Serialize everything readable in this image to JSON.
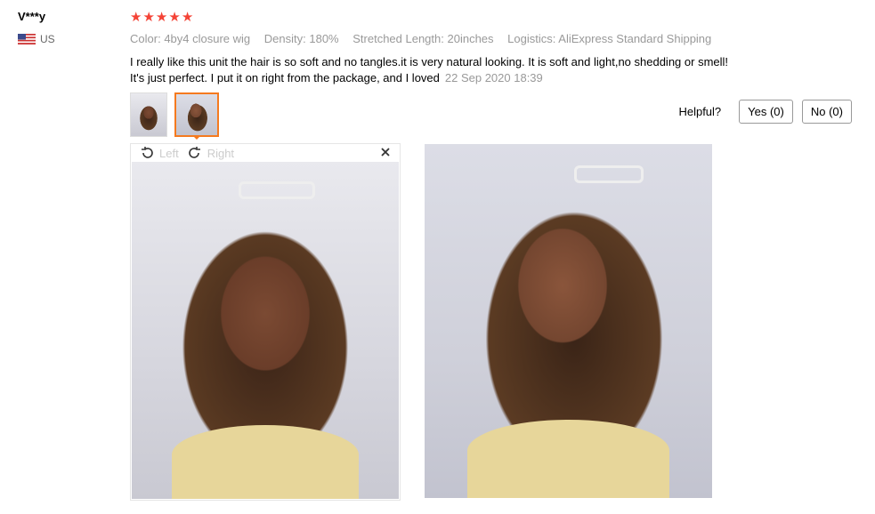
{
  "user": {
    "name": "V***y",
    "country": "US"
  },
  "rating": {
    "stars": 5
  },
  "attributes": [
    {
      "label": "Color:",
      "value": "4by4 closure wig"
    },
    {
      "label": "Density:",
      "value": "180%"
    },
    {
      "label": "Stretched Length:",
      "value": "20inches"
    },
    {
      "label": "Logistics:",
      "value": "AliExpress Standard Shipping"
    }
  ],
  "review": {
    "line1": "I really like this unit the hair is so soft and no tangles.it is very natural looking. It is soft and light,no shedding or smell!",
    "line2": "It's just perfect. I put it on right from the package, and I loved",
    "date": "22 Sep 2020 18:39"
  },
  "helpful": {
    "label": "Helpful?",
    "yes": "Yes (0)",
    "no": "No (0)"
  },
  "viewer": {
    "left_label": "Left",
    "right_label": "Right"
  },
  "colors": {
    "star": "#f44336",
    "active_thumb_border": "#f57a1f"
  },
  "icons": [
    "us-flag-icon",
    "star-icon",
    "rotate-left-icon",
    "rotate-right-icon",
    "close-icon"
  ]
}
